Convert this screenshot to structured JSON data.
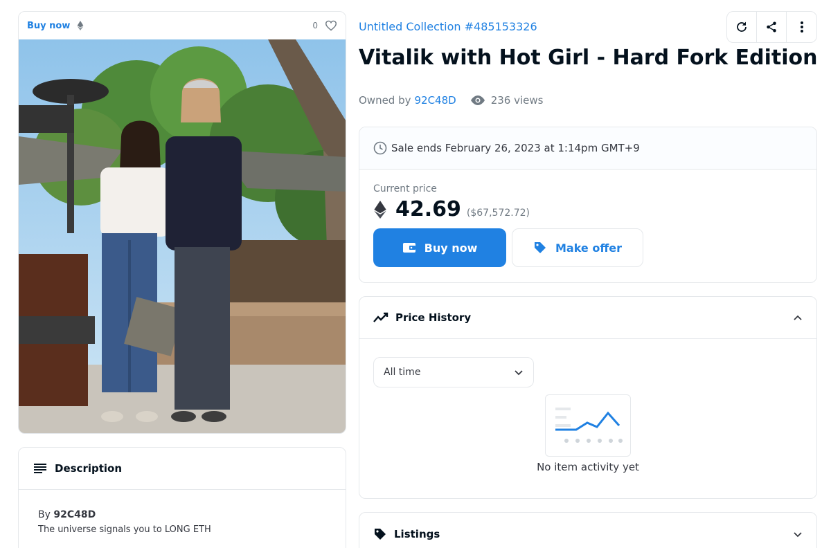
{
  "asset": {
    "buy_tag": "Buy now",
    "like_count": "0",
    "photo_alt": "photo"
  },
  "description": {
    "heading": "Description",
    "by_prefix": "By",
    "creator": "92C48D",
    "text": "The universe signals you to LONG ETH"
  },
  "header": {
    "collection": "Untitled Collection #485153326",
    "title": "Vitalik with Hot Girl - Hard Fork Edition",
    "owned_by_label": "Owned by",
    "owner": "92C48D",
    "views": "236 views"
  },
  "sale": {
    "ends_text": "Sale ends February 26, 2023 at 1:14pm GMT+9",
    "current_price_label": "Current price",
    "price": "42.69",
    "price_usd": "($67,572.72)",
    "buy_label": "Buy now",
    "offer_label": "Make offer"
  },
  "price_history": {
    "heading": "Price History",
    "range_selected": "All time",
    "empty_text": "No item activity yet"
  },
  "listings": {
    "heading": "Listings"
  },
  "colors": {
    "accent": "#2081e2",
    "text_dark": "#04111d",
    "text_muted": "#707a83",
    "border": "#e5e8eb"
  },
  "icons": [
    "ethereum-icon",
    "heart-icon",
    "refresh-icon",
    "share-icon",
    "more-vertical-icon",
    "eye-icon",
    "clock-icon",
    "wallet-icon",
    "tag-icon",
    "trending-icon",
    "chevron-up-icon",
    "chevron-down-icon",
    "list-icon"
  ]
}
